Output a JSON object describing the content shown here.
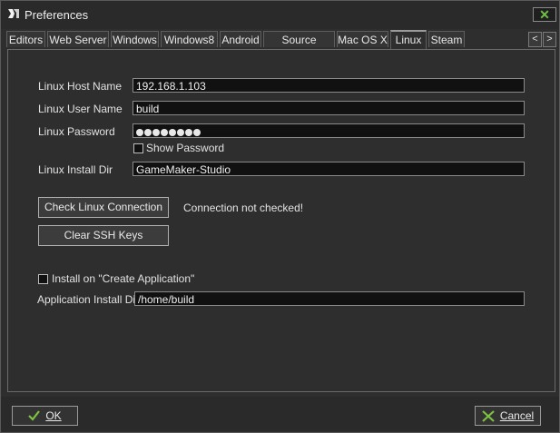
{
  "window": {
    "title": "Preferences"
  },
  "tabs": [
    {
      "label": "Editors",
      "active": false
    },
    {
      "label": "Web Server",
      "active": false
    },
    {
      "label": "Windows",
      "active": false
    },
    {
      "label": "Windows8",
      "active": false
    },
    {
      "label": "Android",
      "active": false
    },
    {
      "label": "Source Control",
      "active": false
    },
    {
      "label": "Mac OS X",
      "active": false
    },
    {
      "label": "Linux",
      "active": true
    },
    {
      "label": "Steam",
      "active": false
    }
  ],
  "linux": {
    "host_label": "Linux Host Name",
    "host_value": "192.168.1.103",
    "user_label": "Linux User Name",
    "user_value": "build",
    "password_label": "Linux Password",
    "password_dots": 8,
    "show_password_label": "Show Password",
    "show_password_checked": false,
    "install_dir_label": "Linux Install Dir",
    "install_dir_value": "GameMaker-Studio",
    "check_connection_label": "Check Linux Connection",
    "connection_status": "Connection not checked!",
    "clear_ssh_label": "Clear SSH Keys",
    "install_on_create_label": "Install on \"Create Application\"",
    "install_on_create_checked": false,
    "app_install_dir_label": "Application Install Dir",
    "app_install_dir_value": "/home/build"
  },
  "footer": {
    "ok_label": "OK",
    "cancel_label": "Cancel"
  },
  "colors": {
    "ok_check": "#7dc242",
    "cancel_x": "#7dc242",
    "close_x": "#6ec04a"
  }
}
